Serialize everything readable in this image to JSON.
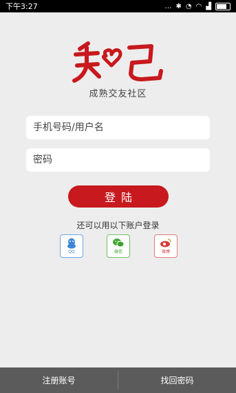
{
  "status_bar": {
    "time": "下午3:27",
    "icons": [
      "more-icon",
      "bluetooth-icon",
      "alarm-icon",
      "wifi-icon",
      "signal-icon",
      "battery-icon"
    ]
  },
  "logo": {
    "text": "知己",
    "slogan": "成熟交友社区",
    "color": "#c7191e"
  },
  "form": {
    "username_placeholder": "手机号码/用户名",
    "password_placeholder": "密码",
    "login_label": "登陆"
  },
  "social": {
    "title": "还可以用以下账户登录",
    "items": [
      {
        "label": "QQ",
        "icon": "qq-icon",
        "color": "#3b86d6"
      },
      {
        "label": "微信",
        "icon": "wechat-icon",
        "color": "#3da32e"
      },
      {
        "label": "微博",
        "icon": "weibo-icon",
        "color": "#d63c3c"
      }
    ]
  },
  "bottom": {
    "register_label": "注册账号",
    "recover_label": "找回密码"
  }
}
